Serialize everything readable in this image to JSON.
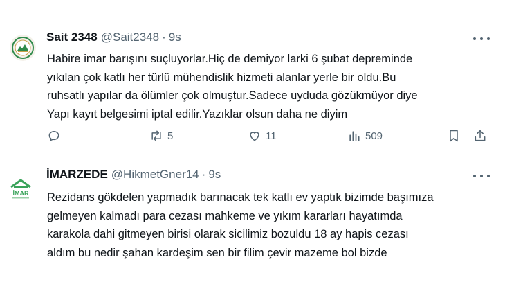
{
  "tweets": [
    {
      "display_name": "Sait 2348",
      "handle": "@Sait2348",
      "separator": "·",
      "time": "9s",
      "avatar_icon": "green-seal-avatar",
      "lines": [
        "Habire imar barışını suçluyorlar.Hiç de demiyor larki 6 şubat depreminde",
        "yıkılan çok katlı her türlü mühendislik hizmeti alanlar yerle bir oldu.Bu",
        "ruhsatlı yapılar da ölümler çok olmuştur.Sadece uyduda gözükmüyor diye",
        "Yapı kayıt belgesimi iptal edilir.Yazıklar olsun daha ne diyim"
      ],
      "actions": {
        "reply_count": "",
        "retweet_count": "5",
        "like_count": "11",
        "views_count": "509"
      }
    },
    {
      "display_name": "İMARZEDE",
      "handle": "@HikmetGner14",
      "separator": "·",
      "time": "9s",
      "avatar_icon": "house-imar-logo-avatar",
      "avatar_logo_text": "İMAR",
      "lines": [
        "Rezidans gökdelen yapmadık barınacak tek katlı ev yaptık bizimde başımıza",
        "gelmeyen kalmadı para cezası mahkeme ve yıkım kararları hayatımda",
        "karakola dahi gitmeyen birisi olarak sicilimiz bozuldu 18 ay hapis cezası",
        "aldım bu nedir şahan kardeşim sen bir filim çevir mazeme bol bizde"
      ]
    }
  ],
  "colors": {
    "text_primary": "#0f1419",
    "text_secondary": "#536471",
    "divider": "#e7e9ea",
    "logo_green": "#3aa35a"
  }
}
